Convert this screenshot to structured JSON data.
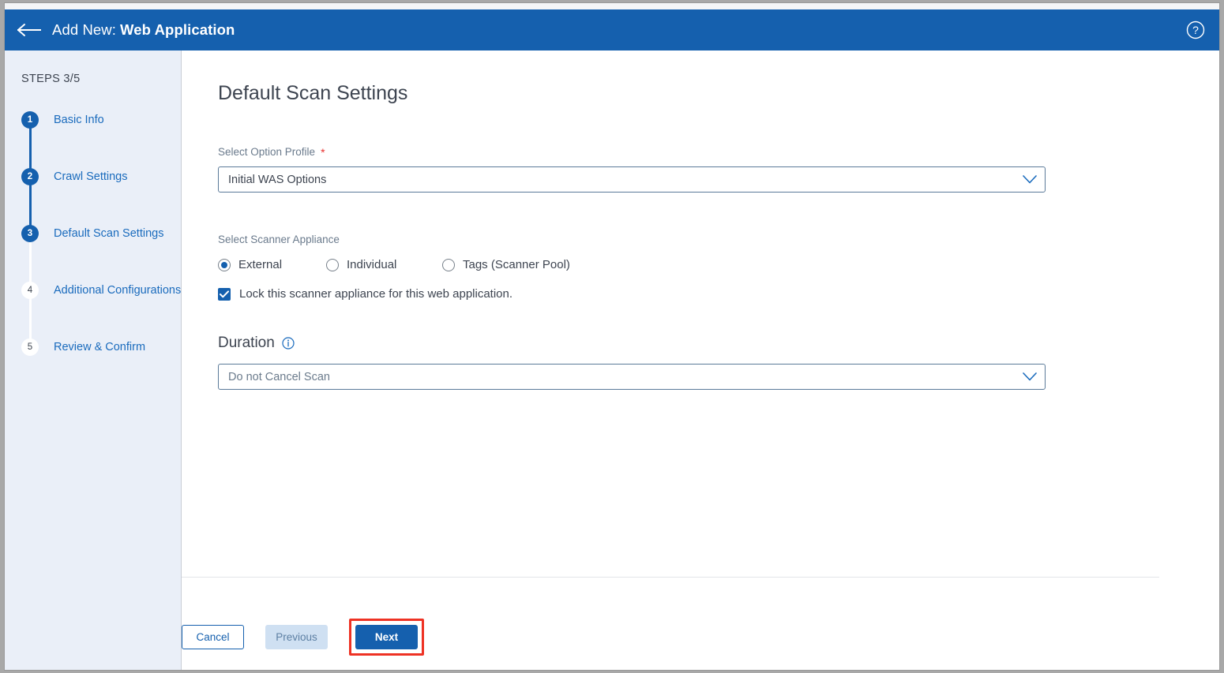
{
  "header": {
    "back_icon": "back-arrow-icon",
    "prefix": "Add New:",
    "title": "Web Application",
    "help_icon": "help-circle-icon"
  },
  "sidebar": {
    "steps_label": "STEPS 3/5",
    "steps": [
      {
        "number": "1",
        "label": "Basic Info",
        "state": "done"
      },
      {
        "number": "2",
        "label": "Crawl Settings",
        "state": "done"
      },
      {
        "number": "3",
        "label": "Default Scan Settings",
        "state": "done"
      },
      {
        "number": "4",
        "label": "Additional Configurations",
        "state": "todo"
      },
      {
        "number": "5",
        "label": "Review & Confirm",
        "state": "todo"
      }
    ]
  },
  "main": {
    "page_title": "Default Scan Settings",
    "option_profile": {
      "label": "Select Option Profile",
      "required_marker": "*",
      "value": "Initial WAS Options",
      "chevron_icon": "chevron-down-icon"
    },
    "scanner_appliance": {
      "label": "Select Scanner Appliance",
      "options": [
        {
          "label": "External",
          "selected": true
        },
        {
          "label": "Individual",
          "selected": false
        },
        {
          "label": "Tags (Scanner Pool)",
          "selected": false
        }
      ],
      "lock_checkbox": {
        "label": "Lock this scanner appliance for this web application.",
        "checked": true
      }
    },
    "duration": {
      "title": "Duration",
      "info_icon": "info-circle-icon",
      "value": "Do not Cancel Scan",
      "chevron_icon": "chevron-down-icon"
    }
  },
  "footer": {
    "cancel_label": "Cancel",
    "previous_label": "Previous",
    "next_label": "Next",
    "next_highlight_color": "#ee3224"
  },
  "colors": {
    "header_blue": "#1560ae",
    "sidebar_bg": "#eaeff8",
    "link_blue": "#1a6bbd",
    "required_red": "#e8312f"
  }
}
